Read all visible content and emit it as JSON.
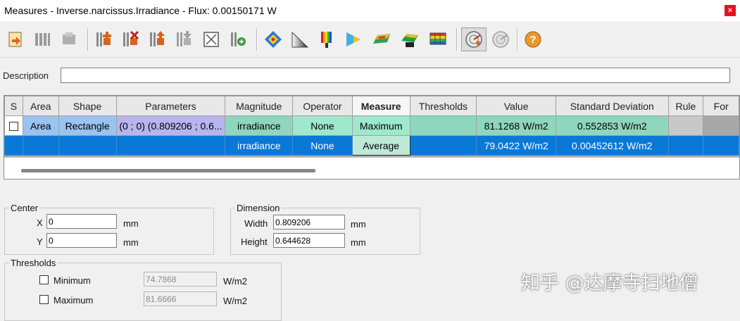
{
  "window": {
    "title": "Measures - Inverse.narcissus.Irradiance - Flux: 0.00150171 W",
    "close": "×"
  },
  "toolbar": {
    "icons": [
      "import-icon",
      "grid-icon",
      "grid-disabled-icon",
      "add-measure-icon",
      "delete-measure-icon",
      "move-up-icon",
      "move-down-icon",
      "fit-icon",
      "add-text-icon",
      "color-diamond-icon",
      "gradient-icon",
      "palette-icon",
      "color-wheel-icon",
      "surface-map-icon",
      "surface-3d-icon",
      "table-color-icon",
      "radar-icon",
      "radar-disabled-icon",
      "help-icon"
    ]
  },
  "description": {
    "label": "Description",
    "value": ""
  },
  "grid": {
    "headers": [
      "S",
      "Area",
      "Shape",
      "Parameters",
      "Magnitude",
      "Operator",
      "Measure",
      "Thresholds",
      "Value",
      "Standard Deviation",
      "Rule",
      "For"
    ],
    "active_header": "Measure",
    "rows": [
      {
        "s": "",
        "area": "Area",
        "shape": "Rectangle",
        "parameters": "(0 ; 0) (0.809206 ; 0.6...",
        "magnitude": "irradiance",
        "operator": "None",
        "measure": "Maximum",
        "thresholds": "",
        "value": "81.1268 W/m2",
        "std": "0.552853 W/m2",
        "rule": "",
        "for": ""
      },
      {
        "s": "",
        "area": "",
        "shape": "",
        "parameters": "",
        "magnitude": "irradiance",
        "operator": "None",
        "measure": "Average",
        "thresholds": "",
        "value": "79.0422 W/m2",
        "std": "0.00452612 W/m2",
        "rule": "",
        "for": ""
      }
    ]
  },
  "center": {
    "legend": "Center",
    "x_label": "X",
    "x_value": "0",
    "x_unit": "mm",
    "y_label": "Y",
    "y_value": "0",
    "y_unit": "mm"
  },
  "dimension": {
    "legend": "Dimension",
    "width_label": "Width",
    "width_value": "0.809206",
    "width_unit": "mm",
    "height_label": "Height",
    "height_value": "0.644628",
    "height_unit": "mm"
  },
  "thresholds": {
    "legend": "Thresholds",
    "min_label": "Minimum",
    "min_value": "74.7868",
    "min_unit": "W/m2",
    "max_label": "Maximum",
    "max_value": "81.6666",
    "max_unit": "W/m2"
  },
  "watermark": "知乎 @达摩寺扫地僧",
  "colors": {
    "selected_row": "#0a78d7",
    "green_cell": "#8ed6be",
    "param_cell": "#b7b4ef"
  }
}
